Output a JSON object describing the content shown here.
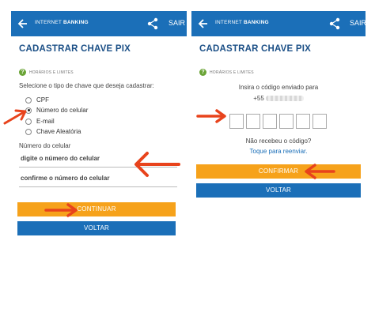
{
  "left_screen": {
    "header": {
      "brand_prefix": "INTERNET",
      "brand_suffix": "BANKING",
      "exit_label": "SAIR"
    },
    "title": "CADASTRAR CHAVE PIX",
    "help_label": "HORÁRIOS E LIMITES",
    "prompt": "Selecione o tipo de chave que deseja cadastrar:",
    "options": [
      {
        "label": "CPF",
        "checked": false
      },
      {
        "label": "Número do celular",
        "checked": true
      },
      {
        "label": "E-mail",
        "checked": false
      },
      {
        "label": "Chave Aleatória",
        "checked": false
      }
    ],
    "field_label": "Número do celular",
    "phone_placeholder": "digite o número do celular",
    "confirm_placeholder": "confirme o número do celular",
    "continue_button": "CONTINUAR",
    "back_button": "VOLTAR"
  },
  "right_screen": {
    "header": {
      "brand_prefix": "INTERNET",
      "brand_suffix": "BANKING",
      "exit_label": "SAIR"
    },
    "title": "CADASTRAR CHAVE PIX",
    "help_label": "HORÁRIOS E LIMITES",
    "code_prompt": "Insira o código enviado para",
    "phone_prefix": "+55",
    "no_code_text": "Não recebeu o código?",
    "resend_link": "Toque para reenviar.",
    "confirm_button": "CONFIRMAR",
    "back_button": "VOLTAR"
  },
  "colors": {
    "header": "#1b6fb8",
    "title": "#1b4f86",
    "orange_button": "#f6a21b",
    "blue_button": "#1b6fb8",
    "arrow": "#e8431c",
    "help_icon": "#6aa436"
  },
  "icons": [
    "back-arrow-icon",
    "share-icon",
    "help-icon",
    "annotation-arrow-icon"
  ]
}
